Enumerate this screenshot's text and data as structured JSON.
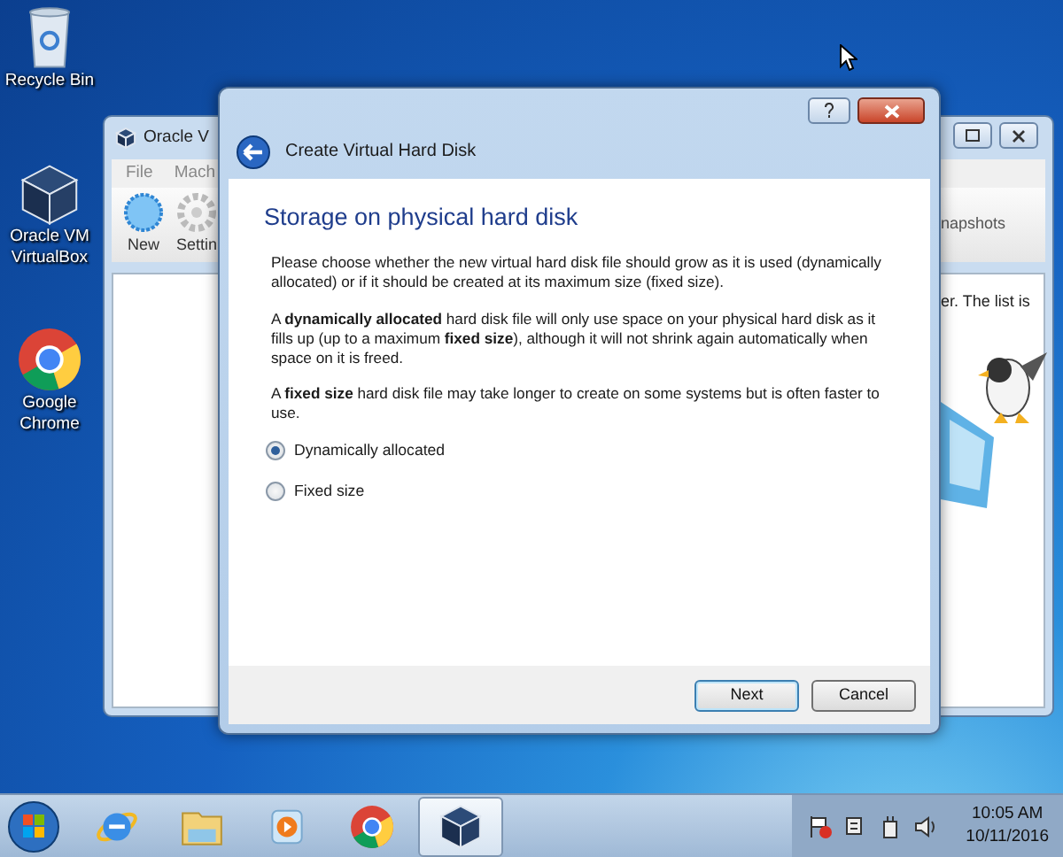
{
  "desktop_icons": [
    {
      "kind": "recycle",
      "label": "Recycle Bin"
    },
    {
      "kind": "virtualbox",
      "label": "Oracle VM VirtualBox"
    },
    {
      "kind": "chrome",
      "label": "Google Chrome"
    }
  ],
  "background_window": {
    "title": "Oracle V",
    "menu": [
      "File",
      "Mach"
    ],
    "toolbar": [
      {
        "kind": "new",
        "label": "New"
      },
      {
        "kind": "settings",
        "label": "Settin"
      }
    ],
    "tab": "napshots",
    "text": "er. The list is"
  },
  "dialog": {
    "title": "Create Virtual Hard Disk",
    "heading": "Storage on physical hard disk",
    "paragraphs": [
      "Please choose whether the new virtual hard disk file should grow as it is used (dynamically allocated) or if it should be created at its maximum size (fixed size).",
      "A **dynamically allocated** hard disk file will only use space on your physical hard disk as it fills up (up to a maximum **fixed size**), although it will not shrink again automatically when space on it is freed.",
      "A **fixed size** hard disk file may take longer to create on some systems but is often faster to use."
    ],
    "options": [
      {
        "label": "Dynamically allocated",
        "selected": true
      },
      {
        "label": "Fixed size",
        "selected": false
      }
    ],
    "buttons": [
      {
        "label": "Next",
        "default": true
      },
      {
        "label": "Cancel",
        "default": false
      }
    ]
  },
  "taskbar": {
    "apps": [
      {
        "kind": "ie",
        "active": false
      },
      {
        "kind": "explorer",
        "active": false
      },
      {
        "kind": "media",
        "active": false
      },
      {
        "kind": "chrome",
        "active": false
      },
      {
        "kind": "virtualbox",
        "active": true
      }
    ],
    "tray": [
      {
        "kind": "flag"
      },
      {
        "kind": "network"
      },
      {
        "kind": "power"
      },
      {
        "kind": "volume"
      }
    ],
    "time": "10:05 AM",
    "date": "10/11/2016"
  }
}
